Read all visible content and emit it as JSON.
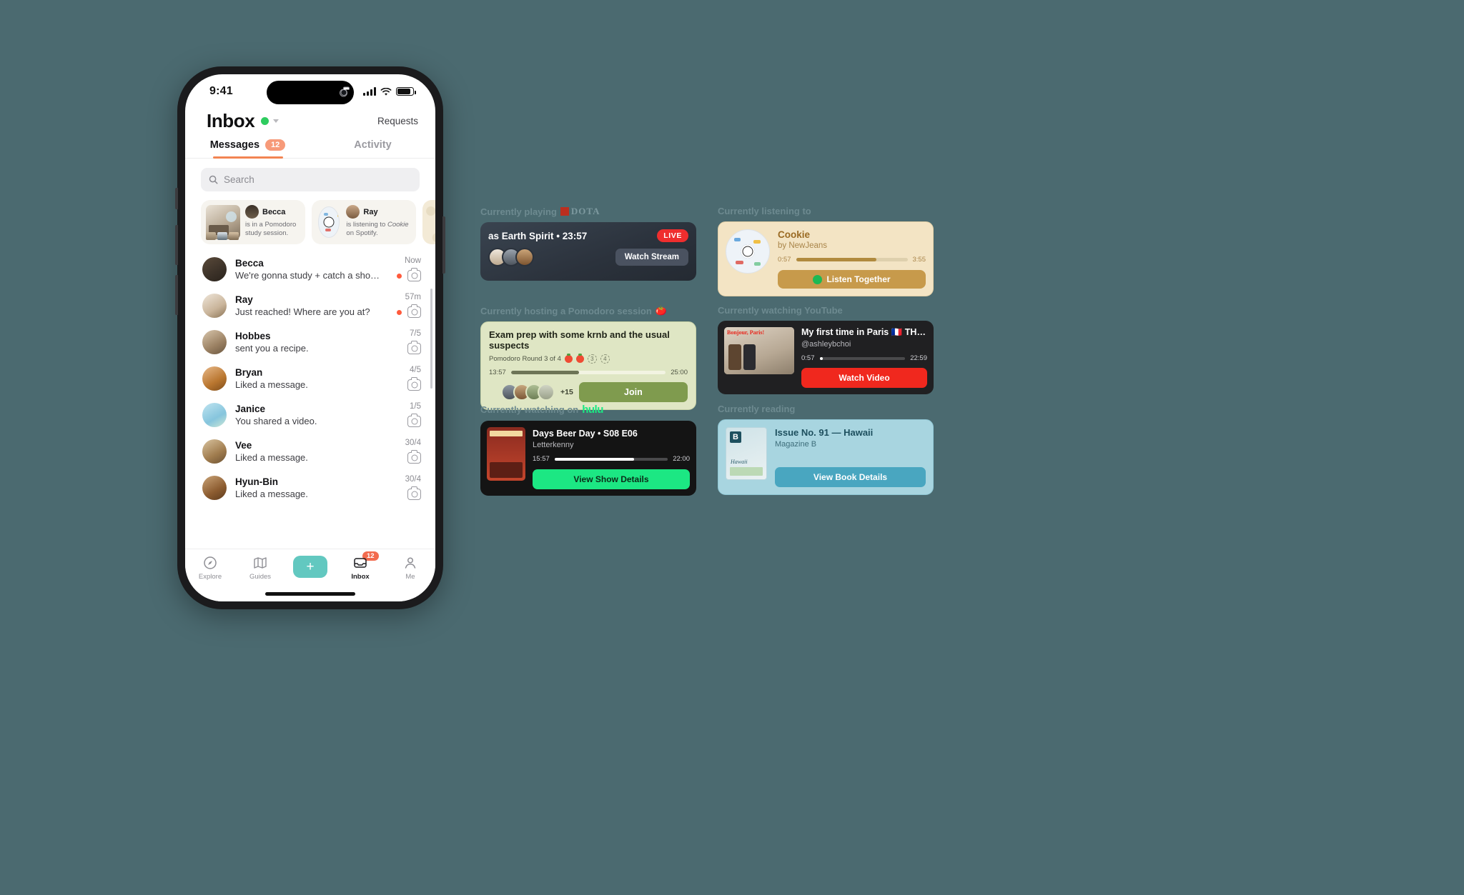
{
  "theme": {
    "background": "#4b6a70",
    "accent": "#f28452",
    "teal": "#62c8c0"
  },
  "phone": {
    "status": {
      "time": "9:41"
    },
    "header": {
      "title": "Inbox",
      "requests_label": "Requests"
    },
    "tabs": [
      {
        "label": "Messages",
        "badge": "12",
        "active": true
      },
      {
        "label": "Activity",
        "badge": "",
        "active": false
      }
    ],
    "search": {
      "placeholder": "Search"
    },
    "presence": [
      {
        "name": "Becca",
        "text": "is in a Pomodoro study session."
      },
      {
        "name": "Ray",
        "text_pre": "is listening to ",
        "track": "Cookie",
        "text_post": " on Spotify."
      }
    ],
    "messages": [
      {
        "name": "Becca",
        "preview": "We're gonna study + catch a sho…",
        "time": "Now",
        "unread": true
      },
      {
        "name": "Ray",
        "preview": "Just reached! Where are you at?",
        "time": "57m",
        "unread": true
      },
      {
        "name": "Hobbes",
        "preview": "sent you a recipe.",
        "time": "7/5",
        "unread": false
      },
      {
        "name": "Bryan",
        "preview": "Liked a message.",
        "time": "4/5",
        "unread": false
      },
      {
        "name": "Janice",
        "preview": "You shared a video.",
        "time": "1/5",
        "unread": false
      },
      {
        "name": "Vee",
        "preview": "Liked a message.",
        "time": "30/4",
        "unread": false
      },
      {
        "name": "Hyun-Bin",
        "preview": "Liked a message.",
        "time": "30/4",
        "unread": false
      }
    ],
    "tabbar": [
      {
        "label": "Explore",
        "icon": "compass-icon",
        "badge": ""
      },
      {
        "label": "Guides",
        "icon": "map-icon",
        "badge": ""
      },
      {
        "label": "",
        "icon": "plus-icon",
        "badge": ""
      },
      {
        "label": "Inbox",
        "icon": "inbox-icon",
        "badge": "12"
      },
      {
        "label": "Me",
        "icon": "person-icon",
        "badge": ""
      }
    ]
  },
  "widgets": {
    "dota": {
      "label": "Currently playing",
      "brand": "DOTA",
      "title": "as Earth Spirit • 23:57",
      "live": "LIVE",
      "button": "Watch Stream"
    },
    "pomodoro": {
      "label": "Currently hosting a Pomodoro session",
      "title": "Exam prep with some krnb and the usual suspects",
      "round": "Pomodoro Round 3 of 4",
      "rounds_done": 2,
      "rounds_total": 4,
      "elapsed": "13:57",
      "total": "25:00",
      "progress": 44,
      "extra_members": "+15",
      "button": "Join"
    },
    "hulu": {
      "label": "Currently watching on",
      "brand": "hulu",
      "title": "Days Beer Day • S08 E06",
      "subtitle": "Letterkenny",
      "elapsed": "15:57",
      "total": "22:00",
      "progress": 70,
      "button": "View Show Details"
    },
    "spotify": {
      "label": "Currently listening to",
      "title": "Cookie",
      "subtitle": "by NewJeans",
      "elapsed": "0:57",
      "total": "3:55",
      "progress": 72,
      "button": "Listen Together"
    },
    "youtube": {
      "label": "Currently watching YouTube",
      "title": "My first time in Paris 🇫🇷 THREE…",
      "channel": "@ashleybchoi",
      "elapsed": "0:57",
      "total": "22:59",
      "progress": 4,
      "thumb_text": "Bonjour, Paris!",
      "button": "Watch Video"
    },
    "magazine": {
      "label": "Currently reading",
      "title": "Issue No. 91 — Hawaii",
      "subtitle": "Magazine B",
      "cover_letter": "B",
      "cover_caption": "Hawaii",
      "button": "View Book Details"
    }
  }
}
